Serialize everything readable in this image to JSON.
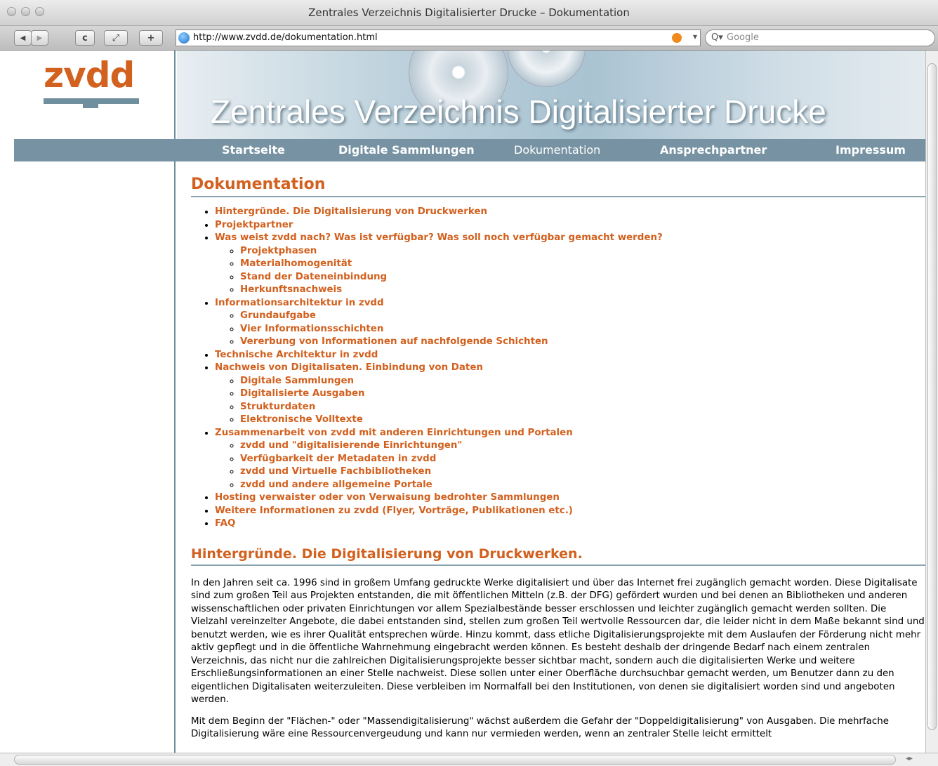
{
  "window": {
    "title": "Zentrales Verzeichnis Digitalisierter Drucke – Dokumentation"
  },
  "toolbar": {
    "back": "◀",
    "forward": "▶",
    "reload": "c",
    "snap": "⤢",
    "add": "+",
    "url": "http://www.zvdd.de/dokumentation.html",
    "search_placeholder": "Google",
    "search_prefix": "Q▾",
    "url_drop": "▾"
  },
  "logo": {
    "text": "zvdd"
  },
  "banner": {
    "title": "Zentrales Verzeichnis Digitalisierter Drucke"
  },
  "nav": {
    "items": [
      "Startseite",
      "Digitale Sammlungen",
      "Dokumentation",
      "Ansprechpartner",
      "Impressum"
    ]
  },
  "main": {
    "heading": "Dokumentation",
    "toc": [
      {
        "label": "Hintergründe. Die Digitalisierung von Druckwerken",
        "children": []
      },
      {
        "label": "Projektpartner",
        "children": []
      },
      {
        "label": "Was weist zvdd nach? Was ist verfügbar? Was soll noch verfügbar gemacht werden?",
        "children": [
          "Projektphasen",
          "Materialhomogenität",
          "Stand der Dateneinbindung",
          "Herkunftsnachweis"
        ]
      },
      {
        "label": "Informationsarchitektur in zvdd",
        "children": [
          "Grundaufgabe",
          "Vier Informationsschichten",
          "Vererbung von Informationen auf nachfolgende Schichten"
        ]
      },
      {
        "label": "Technische Architektur in zvdd",
        "children": []
      },
      {
        "label": "Nachweis von Digitalisaten. Einbindung von Daten",
        "children": [
          "Digitale Sammlungen",
          "Digitalisierte Ausgaben",
          "Strukturdaten",
          "Elektronische Volltexte"
        ]
      },
      {
        "label": "Zusammenarbeit von zvdd mit anderen Einrichtungen und Portalen",
        "children": [
          "zvdd und \"digitalisierende Einrichtungen\"",
          "Verfügbarkeit der Metadaten in zvdd",
          "zvdd und Virtuelle Fachbibliotheken",
          "zvdd und andere allgemeine Portale"
        ]
      },
      {
        "label": "Hosting verwaister oder von Verwaisung bedrohter Sammlungen",
        "children": []
      },
      {
        "label": "Weitere Informationen zu zvdd (Flyer, Vorträge, Publikationen etc.)",
        "children": []
      },
      {
        "label": "FAQ",
        "children": []
      }
    ],
    "section_heading": "Hintergründe. Die Digitalisierung von Druckwerken.",
    "paragraphs": [
      "In den Jahren seit ca. 1996 sind in großem Umfang gedruckte Werke digitalisiert und über das Internet frei zugänglich gemacht worden. Diese Digitalisate sind zum großen Teil aus Projekten entstanden, die mit öffentlichen Mitteln (z.B. der DFG) gefördert wurden und bei denen an Bibliotheken und anderen wissenschaftlichen oder privaten Einrichtungen vor allem Spezialbestände besser erschlossen und leichter zugänglich gemacht werden sollten. Die Vielzahl vereinzelter Angebote, die dabei entstanden sind, stellen zum großen Teil wertvolle Ressourcen dar, die leider nicht in dem Maße bekannt sind und benutzt werden, wie es ihrer Qualität entsprechen würde. Hinzu kommt, dass etliche Digitalisierungsprojekte mit dem Auslaufen der Förderung nicht mehr aktiv gepflegt und in die öffentliche Wahrnehmung eingebracht werden können. Es besteht deshalb der dringende Bedarf nach einem zentralen Verzeichnis, das nicht nur die zahlreichen Digitalisierungsprojekte besser sichtbar macht, sondern auch die digitalisierten Werke und weitere Erschließungsinformationen an einer Stelle nachweist. Diese sollen unter einer Oberfläche durchsuchbar gemacht werden, um Benutzer dann zu den eigentlichen Digitalisaten weiterzuleiten. Diese verbleiben im Normalfall bei den Institutionen, von denen sie digitalisiert worden sind und angeboten werden.",
      "Mit dem Beginn der \"Flächen-\" oder \"Massendigitalisierung\" wächst außerdem die Gefahr der \"Doppeldigitalisierung\" von Ausgaben. Die mehrfache Digitalisierung wäre eine Ressourcenvergeudung und kann nur vermieden werden, wenn an zentraler Stelle leicht ermittelt"
    ]
  },
  "colors": {
    "accent": "#d2611f",
    "nav": "#7793a3",
    "rule": "#8aa3b1"
  }
}
